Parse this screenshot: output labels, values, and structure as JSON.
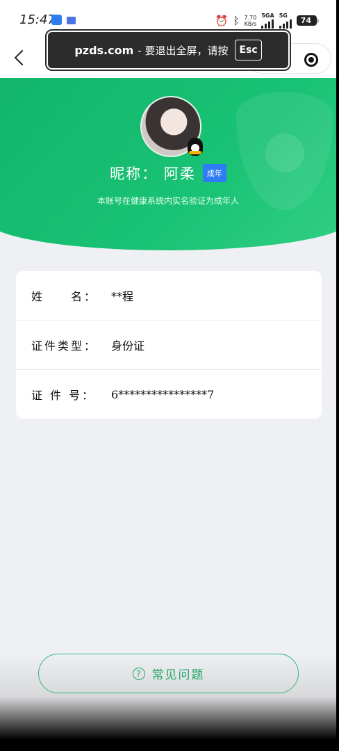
{
  "status_bar": {
    "time": "15:47",
    "net_speed_value": "7.70",
    "net_speed_unit": "KB/s",
    "sim1_label": "5GA",
    "sim2_label": "5G",
    "battery": "74"
  },
  "toast": {
    "domain": "pzds.com",
    "message": "- 要退出全屏，请按",
    "key": "Esc"
  },
  "profile": {
    "nickname": "昵称： 阿柔",
    "badge": "成年",
    "description": "本账号在健康系统内实名验证为成年人"
  },
  "info": [
    {
      "label": "姓　　名：",
      "value": "**程"
    },
    {
      "label": "证件类型：",
      "value": "身份证"
    },
    {
      "label": "证 件 号：",
      "value": "6****************7"
    }
  ],
  "faq": {
    "label": "常见问题",
    "icon": "?"
  },
  "colors": {
    "brand_green": "#19c274",
    "badge_blue": "#2f7cf6",
    "faq_green": "#1fa866"
  }
}
